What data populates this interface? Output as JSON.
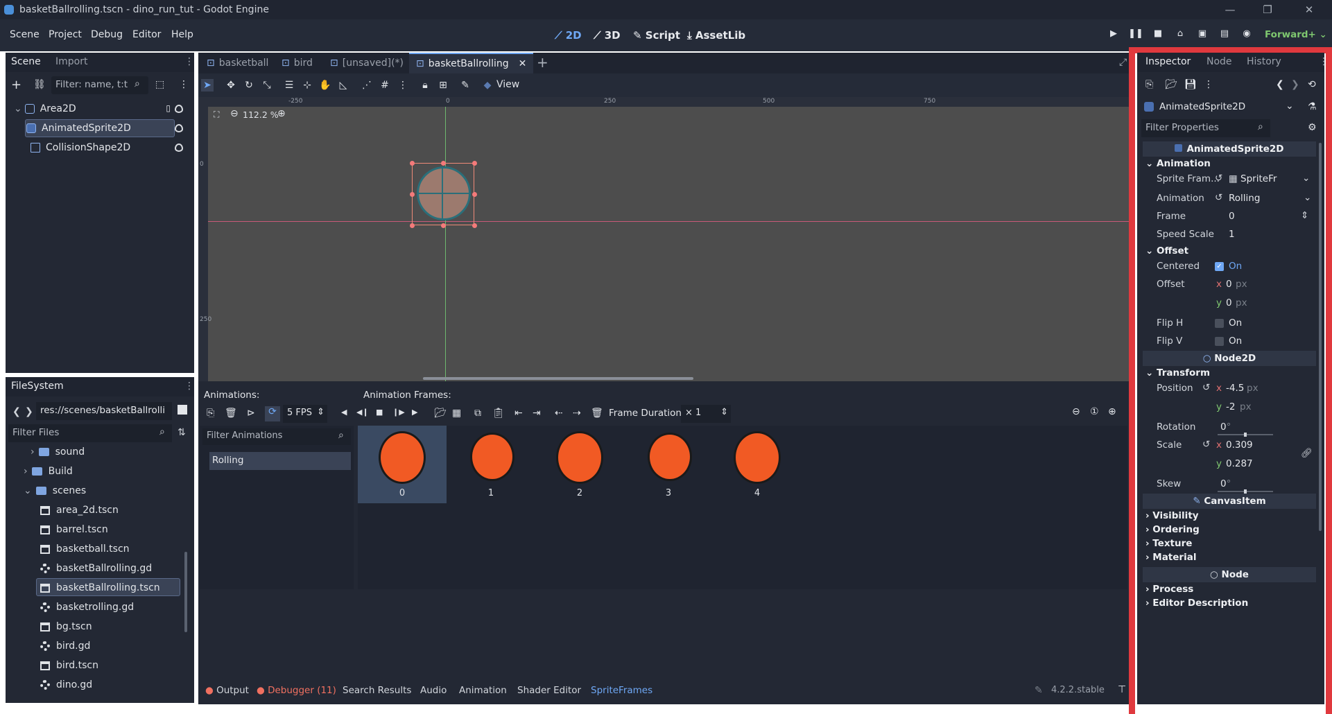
{
  "window": {
    "title": "basketBallrolling.tscn - dino_run_tut - Godot Engine"
  },
  "menu": [
    "Scene",
    "Project",
    "Debug",
    "Editor",
    "Help"
  ],
  "workspaces": [
    "2D",
    "3D",
    "Script",
    "AssetLib"
  ],
  "renderer": "Forward+",
  "scene_dock": {
    "tabs": [
      "Scene",
      "Import"
    ],
    "filter_placeholder": "Filter: name, t:t",
    "nodes": [
      "Area2D",
      "AnimatedSprite2D",
      "CollisionShape2D"
    ]
  },
  "filesystem": {
    "tab": "FileSystem",
    "path": "res://scenes/basketBallrolli",
    "filter_placeholder": "Filter Files",
    "items": [
      "sound",
      "Build",
      "scenes",
      "area_2d.tscn",
      "barrel.tscn",
      "basketball.tscn",
      "basketBallrolling.gd",
      "basketBallrolling.tscn",
      "basketrolling.gd",
      "bg.tscn",
      "bird.gd",
      "bird.tscn",
      "dino.gd"
    ]
  },
  "editor_tabs": [
    "basketball",
    "bird",
    "[unsaved](*)",
    "basketBallrolling"
  ],
  "viewport": {
    "zoom": "112.2 %",
    "view_label": "View",
    "ruler_h": [
      "-250",
      "0",
      "250",
      "500",
      "750"
    ],
    "ruler_v": [
      "0",
      "250"
    ]
  },
  "sprite_frames": {
    "animations_label": "Animations:",
    "frames_label": "Animation Frames:",
    "fps": "5 FPS",
    "frame_duration_label": "Frame Duration:",
    "frame_duration": "× 1",
    "filter_placeholder": "Filter Animations",
    "animations": [
      "Rolling"
    ],
    "frames": [
      "0",
      "1",
      "2",
      "3",
      "4"
    ]
  },
  "bottom_tabs": [
    "Output",
    "Debugger (11)",
    "Search Results",
    "Audio",
    "Animation",
    "Shader Editor",
    "SpriteFrames"
  ],
  "version": "4.2.2.stable",
  "inspector": {
    "tabs": [
      "Inspector",
      "Node",
      "History"
    ],
    "node_name": "AnimatedSprite2D",
    "filter_placeholder": "Filter Properties",
    "class_header": "AnimatedSprite2D",
    "animation_cat": "Animation",
    "sprite_frames_label": "Sprite Fram...",
    "sprite_frames_value": "SpriteFr",
    "animation_label": "Animation",
    "animation_value": "Rolling",
    "frame_label": "Frame",
    "frame_value": "0",
    "speed_label": "Speed Scale",
    "speed_value": "1",
    "offset_cat": "Offset",
    "centered_label": "Centered",
    "centered_value": "On",
    "offset_label": "Offset",
    "offset_x": "0",
    "offset_y": "0",
    "px": "px",
    "fliph_label": "Flip H",
    "fliph_value": "On",
    "flipv_label": "Flip V",
    "flipv_value": "On",
    "node2d_header": "Node2D",
    "transform_cat": "Transform",
    "position_label": "Position",
    "pos_x": "-4.5",
    "pos_y": "-2",
    "rotation_label": "Rotation",
    "rotation_value": "0",
    "scale_label": "Scale",
    "scale_x": "0.309",
    "scale_y": "0.287",
    "skew_label": "Skew",
    "skew_value": "0",
    "deg": "°",
    "canvasitem_header": "CanvasItem",
    "canvas_cats": [
      "Visibility",
      "Ordering",
      "Texture",
      "Material"
    ],
    "node_header": "Node",
    "node_cats": [
      "Process",
      "Editor Description"
    ]
  },
  "colors": {
    "accent": "#6fa8f5",
    "highlight_border": "#e0393e",
    "ball": "#f15a24"
  }
}
